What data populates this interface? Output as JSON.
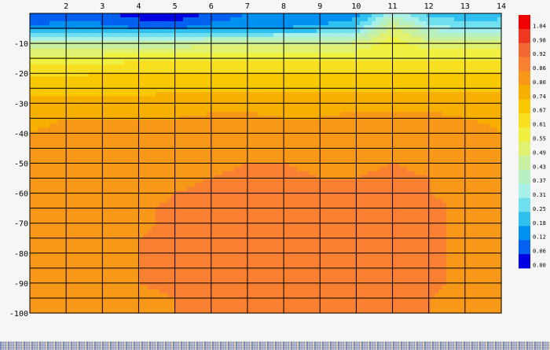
{
  "chart_data": {
    "type": "heatmap",
    "title": "",
    "xlabel": "",
    "ylabel": "",
    "x": [
      1,
      2,
      3,
      4,
      5,
      6,
      7,
      8,
      9,
      10,
      11,
      12,
      13,
      14
    ],
    "x_tick_labels": [
      "2",
      "3",
      "4",
      "5",
      "6",
      "7",
      "8",
      "9",
      "10",
      "11",
      "12",
      "13",
      "14"
    ],
    "xlim": [
      1,
      14
    ],
    "y": [
      0,
      -5,
      -10,
      -15,
      -20,
      -25,
      -30,
      -35,
      -40,
      -45,
      -50,
      -55,
      -60,
      -65,
      -70,
      -75,
      -80,
      -85,
      -90,
      -95,
      -100
    ],
    "y_tick_labels": [
      "-10",
      "-20",
      "-30",
      "-40",
      "-50",
      "-60",
      "-70",
      "-80",
      "-90",
      "-100"
    ],
    "ylim": [
      -100,
      0
    ],
    "grid": true,
    "colorbar": {
      "position": "right",
      "levels": [
        "0.00",
        "0.06",
        "0.12",
        "0.18",
        "0.25",
        "0.31",
        "0.37",
        "0.43",
        "0.49",
        "0.55",
        "0.61",
        "0.67",
        "0.74",
        "0.80",
        "0.86",
        "0.92",
        "0.98",
        "1.04"
      ],
      "colors": [
        "#0000e0",
        "#0060f0",
        "#0090f0",
        "#30c0f0",
        "#70e0f0",
        "#a8f0e8",
        "#b8f0c0",
        "#c8f0a0",
        "#e0f070",
        "#f0f040",
        "#f8e020",
        "#f8c800",
        "#f8b000",
        "#f89818",
        "#f88030",
        "#f06830",
        "#f03820",
        "#f00000"
      ]
    },
    "values": [
      [
        0.06,
        0.1,
        0.08,
        0.02,
        0.0,
        0.08,
        0.12,
        0.12,
        0.12,
        0.14,
        0.35,
        0.22,
        0.2,
        0.22
      ],
      [
        0.14,
        0.14,
        0.14,
        0.12,
        0.12,
        0.14,
        0.16,
        0.18,
        0.2,
        0.25,
        0.52,
        0.35,
        0.3,
        0.3
      ],
      [
        0.45,
        0.45,
        0.45,
        0.45,
        0.45,
        0.47,
        0.47,
        0.48,
        0.48,
        0.5,
        0.58,
        0.52,
        0.5,
        0.5
      ],
      [
        0.58,
        0.58,
        0.58,
        0.59,
        0.59,
        0.59,
        0.59,
        0.6,
        0.6,
        0.6,
        0.6,
        0.6,
        0.6,
        0.6
      ],
      [
        0.66,
        0.66,
        0.67,
        0.67,
        0.67,
        0.67,
        0.67,
        0.67,
        0.67,
        0.67,
        0.67,
        0.67,
        0.67,
        0.67
      ],
      [
        0.72,
        0.72,
        0.72,
        0.72,
        0.73,
        0.73,
        0.73,
        0.73,
        0.73,
        0.73,
        0.73,
        0.73,
        0.73,
        0.73
      ],
      [
        0.76,
        0.76,
        0.76,
        0.76,
        0.77,
        0.78,
        0.78,
        0.79,
        0.78,
        0.79,
        0.79,
        0.79,
        0.78,
        0.77
      ],
      [
        0.79,
        0.8,
        0.8,
        0.8,
        0.8,
        0.81,
        0.81,
        0.8,
        0.8,
        0.81,
        0.81,
        0.81,
        0.8,
        0.79
      ],
      [
        0.8,
        0.81,
        0.81,
        0.81,
        0.82,
        0.83,
        0.83,
        0.83,
        0.83,
        0.83,
        0.83,
        0.83,
        0.82,
        0.8
      ],
      [
        0.81,
        0.82,
        0.82,
        0.82,
        0.84,
        0.85,
        0.85,
        0.85,
        0.84,
        0.84,
        0.85,
        0.85,
        0.83,
        0.81
      ],
      [
        0.81,
        0.82,
        0.83,
        0.83,
        0.84,
        0.85,
        0.86,
        0.86,
        0.85,
        0.85,
        0.86,
        0.85,
        0.84,
        0.82
      ],
      [
        0.82,
        0.83,
        0.83,
        0.84,
        0.85,
        0.86,
        0.87,
        0.87,
        0.86,
        0.86,
        0.87,
        0.86,
        0.84,
        0.82
      ],
      [
        0.82,
        0.83,
        0.84,
        0.84,
        0.86,
        0.87,
        0.87,
        0.87,
        0.86,
        0.87,
        0.87,
        0.86,
        0.85,
        0.82
      ],
      [
        0.83,
        0.83,
        0.84,
        0.85,
        0.87,
        0.87,
        0.87,
        0.87,
        0.87,
        0.87,
        0.87,
        0.87,
        0.85,
        0.82
      ],
      [
        0.85,
        0.84,
        0.84,
        0.85,
        0.87,
        0.87,
        0.87,
        0.87,
        0.87,
        0.87,
        0.87,
        0.87,
        0.85,
        0.82
      ],
      [
        0.85,
        0.84,
        0.84,
        0.86,
        0.87,
        0.87,
        0.87,
        0.87,
        0.87,
        0.87,
        0.87,
        0.87,
        0.85,
        0.82
      ],
      [
        0.84,
        0.84,
        0.84,
        0.86,
        0.87,
        0.87,
        0.87,
        0.87,
        0.87,
        0.88,
        0.87,
        0.87,
        0.85,
        0.83
      ],
      [
        0.84,
        0.84,
        0.84,
        0.86,
        0.87,
        0.87,
        0.87,
        0.87,
        0.87,
        0.88,
        0.87,
        0.87,
        0.85,
        0.83
      ],
      [
        0.84,
        0.84,
        0.84,
        0.86,
        0.87,
        0.87,
        0.87,
        0.87,
        0.87,
        0.88,
        0.87,
        0.87,
        0.85,
        0.83
      ],
      [
        0.84,
        0.84,
        0.84,
        0.85,
        0.86,
        0.87,
        0.87,
        0.87,
        0.87,
        0.87,
        0.87,
        0.86,
        0.85,
        0.83
      ],
      [
        0.84,
        0.84,
        0.84,
        0.85,
        0.86,
        0.86,
        0.86,
        0.86,
        0.86,
        0.86,
        0.86,
        0.86,
        0.85,
        0.83
      ]
    ]
  }
}
